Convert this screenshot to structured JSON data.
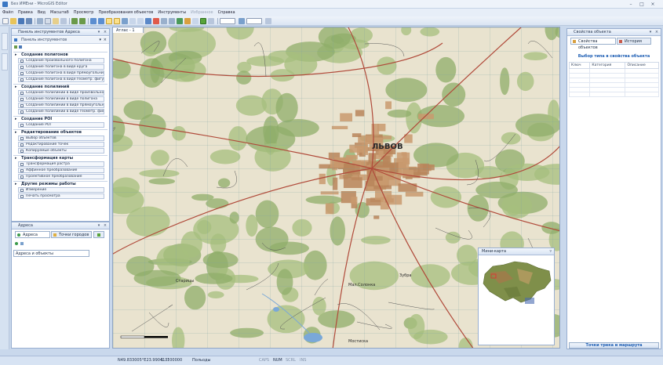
{
  "window": {
    "title": "Без ИМЕни - MicroGIS Editor",
    "minimize": "–",
    "maximize": "□",
    "close": "×"
  },
  "menu": [
    "Файл",
    "Правка",
    "Вид",
    "Масштаб",
    "Просмотр",
    "Преобразования объектов",
    "Инструменты",
    "Избранное",
    "Справка"
  ],
  "menu_disabled_index": 7,
  "left_panel": {
    "title": "Панель инструментов Адреса",
    "subtitle": "Панель инструментов",
    "sections": [
      {
        "title": "Создание полигонов",
        "items": [
          "Создание произвольного полигона",
          "Создание полигона в виде круга",
          "Создание полигона в виде прямоугольника",
          "Создание полигона в виде геометр. фигуры"
        ]
      },
      {
        "title": "Создание полилиний",
        "items": [
          "Создание полилинии в виде произвольной л...",
          "Создание полилинии в виде полигона",
          "Создание полилинии в виде прямоугольника",
          "Создание полилинии в виде геометр. фигуры"
        ]
      },
      {
        "title": "Создание POI",
        "items": [
          "Создание POI"
        ]
      },
      {
        "title": "Редактирование объектов",
        "items": [
          "Выбор объектов",
          "Редактирование точек",
          "Копируемые объекты"
        ]
      },
      {
        "title": "Трансформация карты",
        "items": [
          "Трансформация растра",
          "Аффинное преобразование",
          "Проективное преобразование"
        ]
      },
      {
        "title": "Другие режимы работы",
        "items": [
          "Измерение",
          "Печать просмотра"
        ]
      }
    ]
  },
  "addr_panel": {
    "title": "Адреса",
    "tabs": [
      "Адреса",
      "Точки городов"
    ],
    "field": "Адреса и объекты"
  },
  "map": {
    "tab": "Атлас - 1",
    "city_label": "ЛЬВОВ",
    "place_labels": [
      "Мал.Солонка",
      "Зубра",
      "Старицы",
      "Мостиска"
    ],
    "minimap_title": "Мини-карта",
    "minimap_icon": "pin-icon"
  },
  "right_panel": {
    "title": "Свойства объекта",
    "tabs": [
      "Свойства объектов",
      "История"
    ],
    "heading": "Выбор типа в свойства объекта",
    "columns": [
      "Ключ",
      "Категория",
      "Описание"
    ],
    "bottom_button": "Точки трека и маршрута"
  },
  "status": {
    "coords": "N49.833005°E23.990413°",
    "scale": "1 : 100000",
    "mode": "Польоды",
    "indicators": [
      "CAPS",
      "NUM",
      "SCRL",
      "INS"
    ]
  },
  "colors": {
    "accent": "#3b78c4",
    "header_text": "#1f5fb4",
    "map_green": "#8fae6a",
    "map_urban": "#c99a6e",
    "map_base": "#e9e3cf"
  }
}
